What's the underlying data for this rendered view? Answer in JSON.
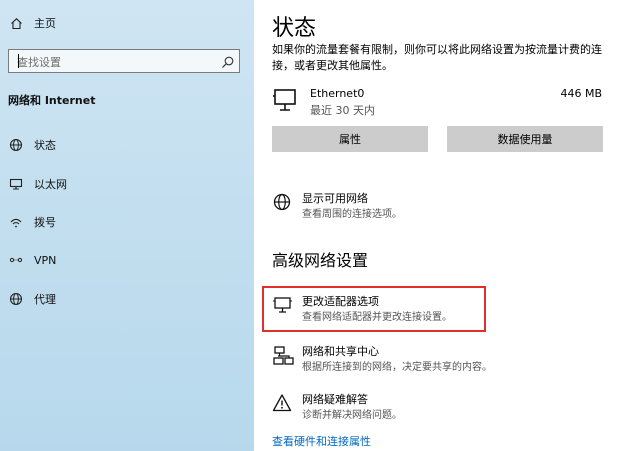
{
  "sidebar": {
    "home_label": "主页",
    "search_placeholder": "查找设置",
    "section_title": "网络和 Internet",
    "items": [
      {
        "label": "状态",
        "icon": "status-globe-icon"
      },
      {
        "label": "以太网",
        "icon": "ethernet-icon"
      },
      {
        "label": "拨号",
        "icon": "dialup-icon"
      },
      {
        "label": "VPN",
        "icon": "vpn-icon"
      },
      {
        "label": "代理",
        "icon": "proxy-globe-icon"
      }
    ]
  },
  "main": {
    "title": "状态",
    "description": "如果你的流量套餐有限制，则你可以将此网络设置为按流量计费的连接，或者更改其他属性。",
    "connection": {
      "name": "Ethernet0",
      "subtitle": "最近 30 天内",
      "data_used": "446 MB"
    },
    "buttons": {
      "properties": "属性",
      "data_usage": "数据使用量"
    },
    "show_networks": {
      "title": "显示可用网络",
      "subtitle": "查看周围的连接选项。"
    },
    "advanced_title": "高级网络设置",
    "advanced_items": [
      {
        "title": "更改适配器选项",
        "subtitle": "查看网络适配器并更改连接设置。"
      },
      {
        "title": "网络和共享中心",
        "subtitle": "根据所连接到的网络，决定要共享的内容。"
      },
      {
        "title": "网络疑难解答",
        "subtitle": "诊断并解决网络问题。"
      }
    ],
    "link": "查看硬件和连接属性"
  },
  "colors": {
    "highlight": "#e0302c",
    "link": "#0067c0",
    "button_bg": "#cccccc"
  }
}
